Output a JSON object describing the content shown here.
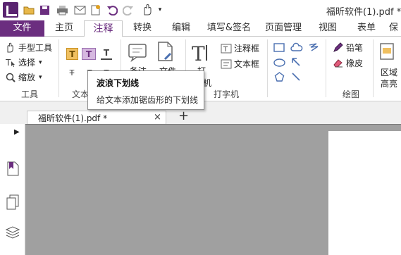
{
  "title": "福昕软件(1).pdf * -",
  "quick_access": [
    "open-icon",
    "save-icon",
    "print-icon",
    "email-icon",
    "new-icon",
    "undo-icon",
    "redo-icon",
    "hand-icon",
    "dropdown-icon"
  ],
  "tabs": [
    "文件",
    "主页",
    "注释",
    "转换",
    "编辑",
    "填写&签名",
    "页面管理",
    "视图",
    "表单",
    "保"
  ],
  "active_tab": "注释",
  "ribbon": {
    "tools": {
      "hand": "手型工具",
      "select": "选择",
      "zoom": "缩放",
      "group": "工具"
    },
    "text_group": {
      "label": "文本"
    },
    "note": "备注",
    "file": "文件",
    "typewriter": {
      "type": "打",
      "machine": "机",
      "note_box": "注释框",
      "text_box": "文本框",
      "group": "打字机"
    },
    "draw": {
      "pencil": "铅笔",
      "eraser": "橡皮",
      "group": "绘图"
    },
    "area": {
      "top": "区域",
      "bottom": "高亮"
    }
  },
  "tooltip": {
    "title": "波浪下划线",
    "description": "给文本添加锯齿形的下划线"
  },
  "doc_tab": {
    "label": "福昕软件(1).pdf *",
    "close": "×",
    "add": "+"
  },
  "colors": {
    "accent": "#6b2e7f",
    "canvas": "#a0a0a0",
    "highlight": "#f0c060"
  }
}
